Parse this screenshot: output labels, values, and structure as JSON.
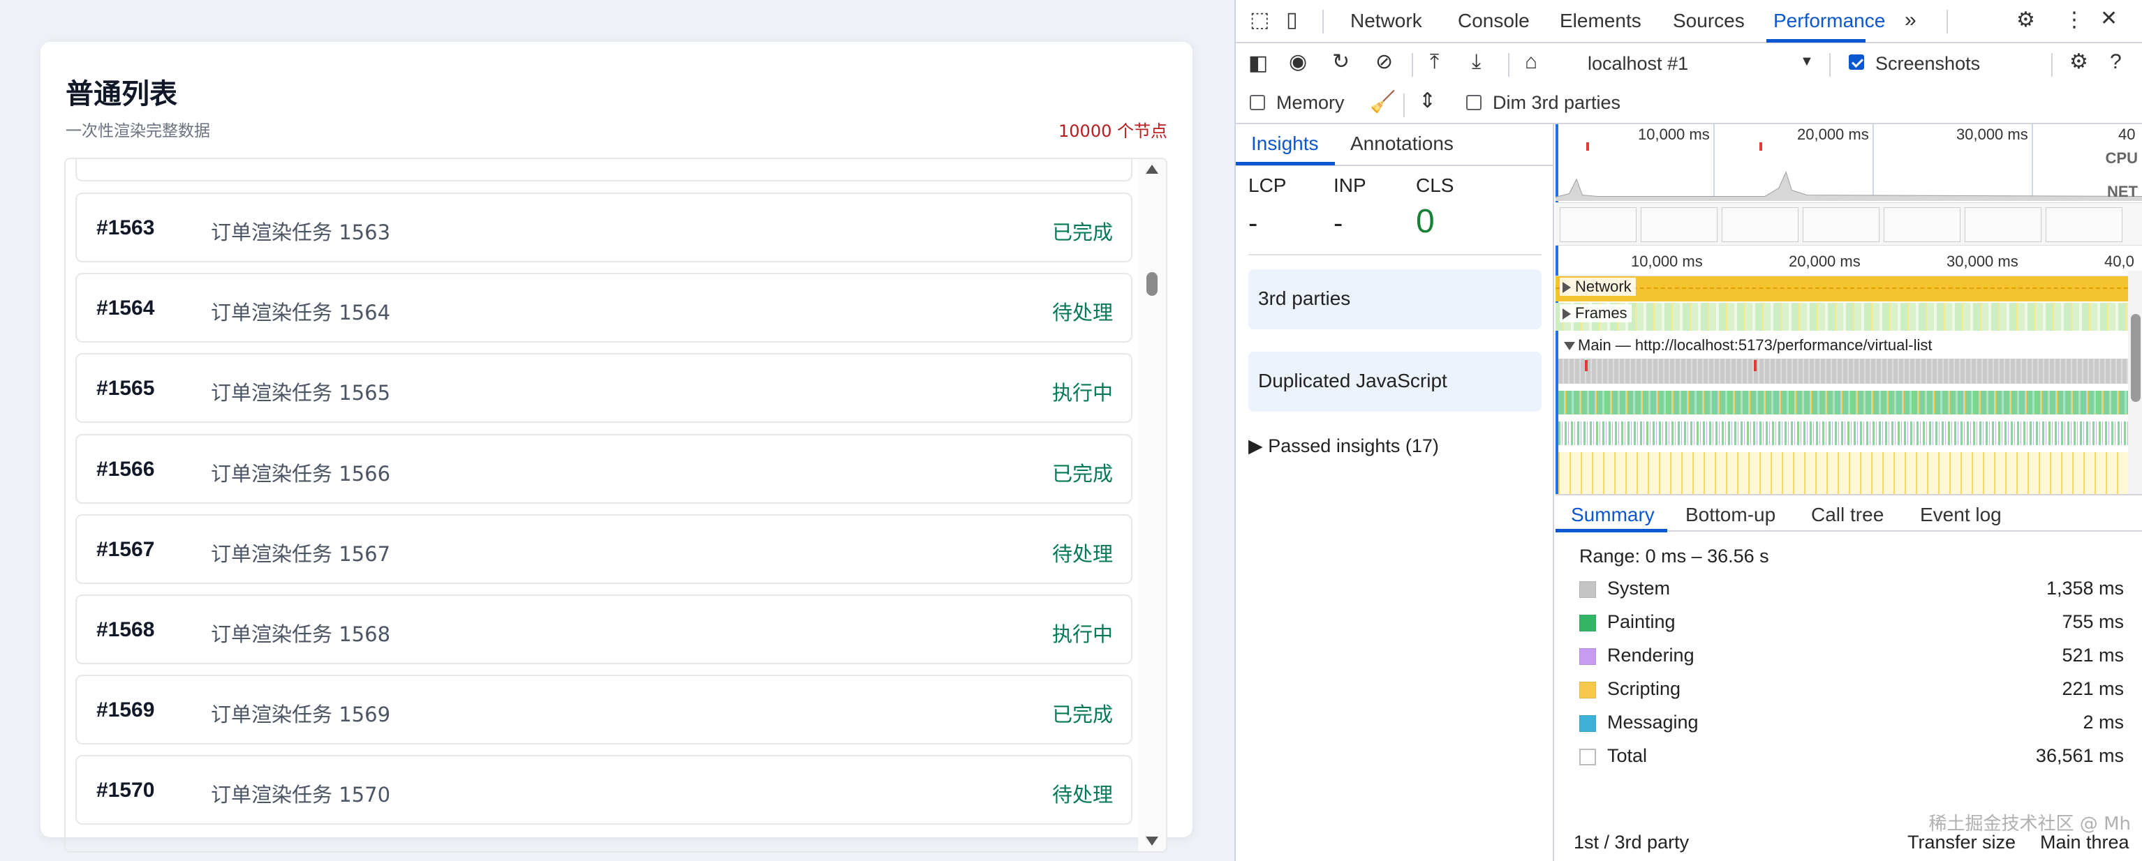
{
  "app": {
    "title": "普通列表",
    "subtitle": "一次性渲染完整数据",
    "count_label": "10000 个节点",
    "rows": [
      {
        "id": "#1563",
        "title": "订单渲染任务 1563",
        "status": "已完成"
      },
      {
        "id": "#1564",
        "title": "订单渲染任务 1564",
        "status": "待处理"
      },
      {
        "id": "#1565",
        "title": "订单渲染任务 1565",
        "status": "执行中"
      },
      {
        "id": "#1566",
        "title": "订单渲染任务 1566",
        "status": "已完成"
      },
      {
        "id": "#1567",
        "title": "订单渲染任务 1567",
        "status": "待处理"
      },
      {
        "id": "#1568",
        "title": "订单渲染任务 1568",
        "status": "执行中"
      },
      {
        "id": "#1569",
        "title": "订单渲染任务 1569",
        "status": "已完成"
      },
      {
        "id": "#1570",
        "title": "订单渲染任务 1570",
        "status": "待处理"
      }
    ],
    "colors": {
      "status": "#047857",
      "count": "#b91c1c"
    }
  },
  "devtools": {
    "tabs": [
      "Network",
      "Console",
      "Elements",
      "Sources",
      "Performance"
    ],
    "active_tab": "Performance",
    "more_icon": "chevron-double-right-icon",
    "target": "localhost #1",
    "screenshots_label": "Screenshots",
    "screenshots_checked": true,
    "memory_label": "Memory",
    "memory_checked": false,
    "dim_label": "Dim 3rd parties",
    "dim_checked": false,
    "insights": {
      "tabs": [
        "Insights",
        "Annotations"
      ],
      "metrics": [
        {
          "label": "LCP",
          "value": "-"
        },
        {
          "label": "INP",
          "value": "-"
        },
        {
          "label": "CLS",
          "value": "0"
        }
      ],
      "items": [
        "3rd parties",
        "Duplicated JavaScript"
      ],
      "passed": "Passed insights (17)"
    },
    "timeline": {
      "overview_ticks": [
        "10,000 ms",
        "20,000 ms",
        "30,000 ms",
        "40"
      ],
      "ruler_ticks": [
        "10,000 ms",
        "20,000 ms",
        "30,000 ms",
        "40,0"
      ],
      "cpu_label": "CPU",
      "net_label": "NET",
      "tracks": [
        "Network",
        "Frames"
      ],
      "main_track": "Main — http://localhost:5173/performance/virtual-list"
    },
    "summary": {
      "tabs": [
        "Summary",
        "Bottom-up",
        "Call tree",
        "Event log"
      ],
      "range": "Range: 0 ms – 36.56 s",
      "rows": [
        {
          "name": "System",
          "value": "1,358 ms",
          "color": "#c4c4c4"
        },
        {
          "name": "Painting",
          "value": "755 ms",
          "color": "#34b565"
        },
        {
          "name": "Rendering",
          "value": "521 ms",
          "color": "#c79bf2"
        },
        {
          "name": "Scripting",
          "value": "221 ms",
          "color": "#f6c84c"
        },
        {
          "name": "Messaging",
          "value": "2 ms",
          "color": "#3fb1d6"
        },
        {
          "name": "Total",
          "value": "36,561 ms",
          "color": "#ffffff"
        }
      ],
      "footer": {
        "party": "1st / 3rd party",
        "transfer": "Transfer size",
        "main": "Main threa"
      },
      "watermark": "稀土掘金技术社区 @ Mh"
    }
  }
}
